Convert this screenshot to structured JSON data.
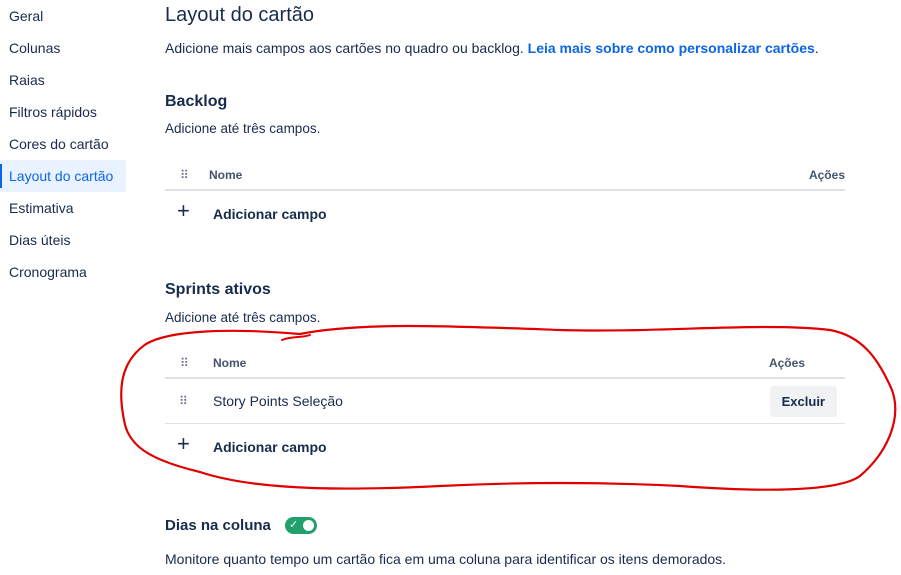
{
  "sidebar": {
    "items": [
      {
        "label": "Geral"
      },
      {
        "label": "Colunas"
      },
      {
        "label": "Raias"
      },
      {
        "label": "Filtros rápidos"
      },
      {
        "label": "Cores do cartão"
      },
      {
        "label": "Layout do cartão",
        "active": true
      },
      {
        "label": "Estimativa"
      },
      {
        "label": "Dias úteis"
      },
      {
        "label": "Cronograma"
      }
    ]
  },
  "main": {
    "title": "Layout do cartão",
    "intro_text": "Adicione mais campos aos cartões no quadro ou backlog. ",
    "intro_link": "Leia mais sobre como personalizar cartões",
    "intro_end": ".",
    "backlog": {
      "title": "Backlog",
      "description": "Adicione até três campos.",
      "col_name": "Nome",
      "col_actions": "Ações",
      "add_label": "Adicionar campo"
    },
    "sprints": {
      "title": "Sprints ativos",
      "description": "Adicione até três campos.",
      "col_name": "Nome",
      "col_actions": "Ações",
      "rows": [
        {
          "name": "Story Points Seleção",
          "action": "Excluir"
        }
      ],
      "add_label": "Adicionar campo"
    },
    "days_in_column": {
      "label": "Dias na coluna",
      "enabled": true,
      "description": "Monitore quanto tempo um cartão fica em uma coluna para identificar os itens demorados."
    }
  },
  "colors": {
    "accent": "#0c66e4",
    "toggle_on": "#22a06b",
    "annotation": "#e00000"
  },
  "icons": {
    "drag": "drag-handle-icon",
    "add": "plus-icon",
    "toggle_check": "check-icon"
  }
}
